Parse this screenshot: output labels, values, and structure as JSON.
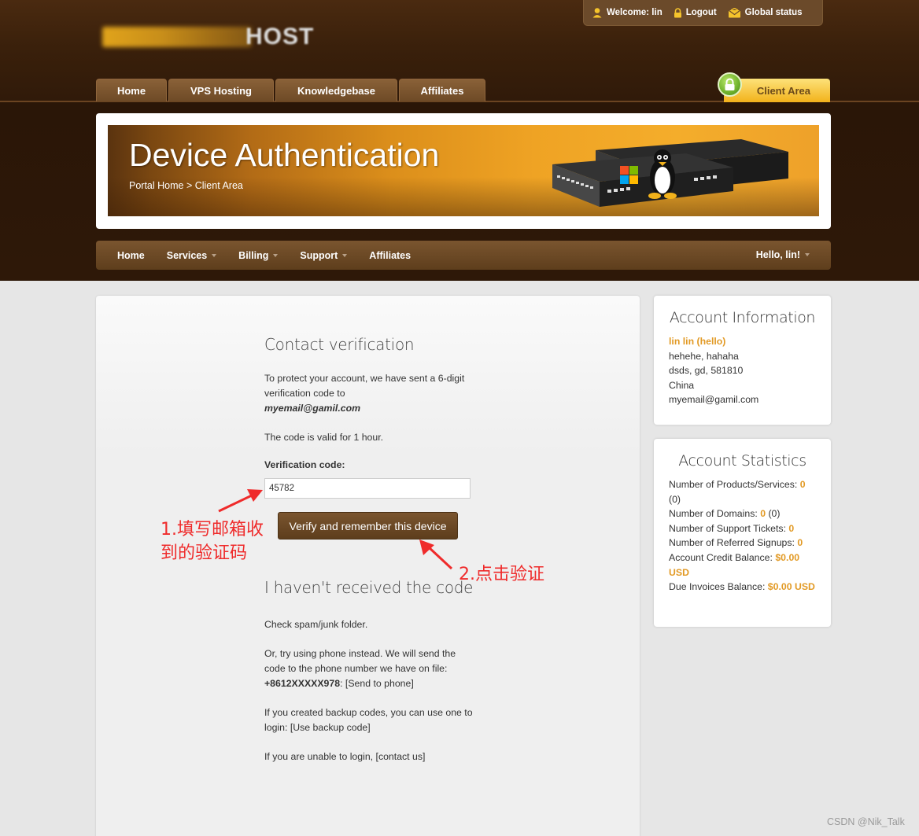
{
  "header": {
    "logo_text": "HOST",
    "topbar": {
      "welcome": "Welcome: lin",
      "logout": "Logout",
      "global_status": "Global status"
    },
    "main_tabs": [
      "Home",
      "VPS Hosting",
      "Knowledgebase",
      "Affiliates"
    ],
    "client_area": "Client Area"
  },
  "banner": {
    "title": "Device Authentication",
    "breadcrumb": "Portal Home > Client Area"
  },
  "subnav": {
    "items": [
      "Home",
      "Services",
      "Billing",
      "Support",
      "Affiliates"
    ],
    "hello": "Hello, lin!"
  },
  "main": {
    "contact_title": "Contact verification",
    "protect_text": "To protect your account, we have sent a 6-digit verification code to",
    "email": "myemail@gamil.com",
    "valid_text": "The code is valid for 1 hour.",
    "code_label": "Verification code:",
    "code_value": "45782",
    "verify_button": "Verify and remember this device",
    "not_received_title": "I haven't received the code",
    "spam_text": "Check spam/junk folder.",
    "phone_text": "Or, try using phone instead. We will send the code to the phone number we have on file:",
    "phone_number": "+8612XXXXX978",
    "send_phone": "[Send to phone]",
    "backup_text": "If you created backup codes, you can use one to login:",
    "backup_link": "[Use backup code]",
    "unable_text": "If you are unable to login,",
    "contact_link": "[contact us]"
  },
  "sidebar": {
    "account_info": {
      "title": "Account Information",
      "name": "lin lin (hello)",
      "address1": "hehehe, hahaha",
      "address2": "dsds, gd, 581810",
      "country": "China",
      "email": "myemail@gamil.com"
    },
    "account_stats": {
      "title": "Account Statistics",
      "products_label": "Number of Products/Services:",
      "products_value": "0",
      "products_extra": "(0)",
      "domains_label": "Number of Domains:",
      "domains_value": "0",
      "domains_extra": "(0)",
      "tickets_label": "Number of Support Tickets:",
      "tickets_value": "0",
      "referred_label": "Number of Referred Signups:",
      "referred_value": "0",
      "credit_label": "Account Credit Balance:",
      "credit_value": "$0.00 USD",
      "due_label": "Due Invoices Balance:",
      "due_value": "$0.00 USD"
    }
  },
  "annotations": {
    "step1_line1": "1.填写邮箱收",
    "step1_line2": "到的验证码",
    "step2": "2.点击验证"
  },
  "watermark": "CSDN @Nik_Talk",
  "colors": {
    "accent_orange": "#e29a25",
    "brown_nav": "#6e4a26",
    "annotation_red": "#ef2b2b"
  }
}
